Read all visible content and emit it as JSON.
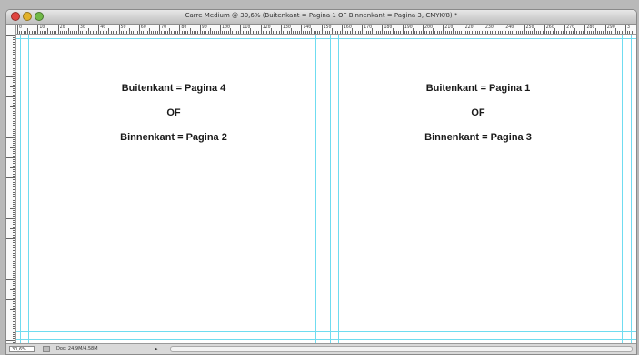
{
  "window": {
    "title": "Carre Medium @ 30,6% (Buitenkant = Pagina 1  OF  Binnenkant = Pagina 3, CMYK/8) *"
  },
  "ruler": {
    "top_labels": [
      "0",
      "10",
      "20",
      "30",
      "40",
      "50",
      "60",
      "70",
      "80",
      "90",
      "100",
      "110",
      "120",
      "130",
      "140",
      "150",
      "160",
      "170",
      "180",
      "190",
      "200",
      "210",
      "220",
      "230",
      "240",
      "250",
      "260",
      "270",
      "280",
      "290",
      "3"
    ]
  },
  "left_page": {
    "line1": "Buitenkant = Pagina 4",
    "line2": "OF",
    "line3": "Binnenkant = Pagina 2"
  },
  "right_page": {
    "line1": "Buitenkant = Pagina 1",
    "line2": "OF",
    "line3": "Binnenkant = Pagina 3"
  },
  "status": {
    "zoom": "30,6%",
    "doc_info": "Doc: 24,9M/4,58M",
    "arrow": "▸"
  },
  "colors": {
    "guide": "#6fdcf0",
    "canvas": "#ffffff"
  }
}
